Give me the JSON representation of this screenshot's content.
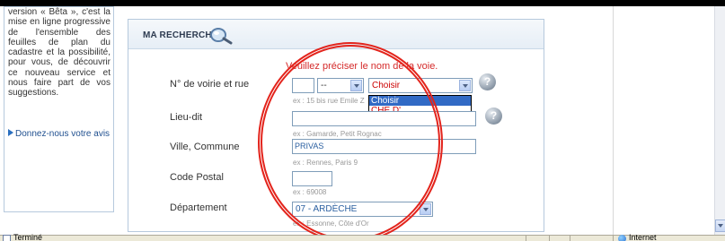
{
  "infobox": {
    "text": "version « Bêta », c'est la mise en ligne progressive de l'ensemble des feuilles de plan du cadastre et la possibilité, pour vous, de découvrir ce nouveau service et nous faire part de vos suggestions.",
    "link": "Donnez-nous votre avis"
  },
  "panel": {
    "title": "MA RECHERCHE",
    "warning": "Veuillez préciser le nom de la voie.",
    "street": {
      "label": "N° de voirie et rue",
      "number_value": "",
      "suffix_value": "--",
      "street_selected": "Choisir",
      "hint": "ex : 15 bis rue Emile Z",
      "dropdown_options": [
        "Choisir",
        "CHE D' ARGEVILLIERES"
      ]
    },
    "lieu_dit": {
      "label": "Lieu-dit",
      "value": "",
      "hint": "ex : Gamarde, Petit Rognac"
    },
    "ville": {
      "label": "Ville, Commune",
      "value": "PRIVAS",
      "hint": "ex : Rennes, Paris 9"
    },
    "code_postal": {
      "label": "Code Postal",
      "value": "",
      "hint": "ex : 69008"
    },
    "departement": {
      "label": "Département",
      "value": "07 - ARDÈCHE",
      "hint": "ex : Essonne, Côte d'Or"
    }
  },
  "statusbar": {
    "left": "Terminé",
    "zone": "Internet"
  },
  "colors": {
    "warning": "#d52a2a",
    "annotation": "#e3241c",
    "selection": "#316ac5"
  }
}
